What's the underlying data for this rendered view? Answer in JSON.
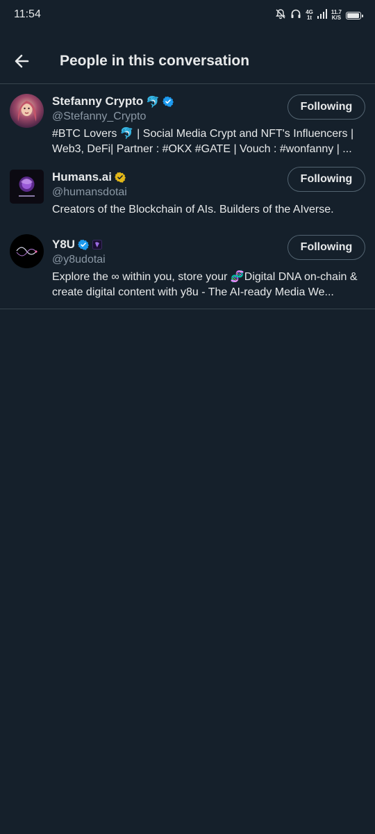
{
  "status_bar": {
    "time": "11:54",
    "network": "4G",
    "network_sub": "1t",
    "speed_value": "11.7",
    "speed_unit": "K/S",
    "battery_level": 0.95,
    "icons": [
      "mute-icon",
      "headset-icon",
      "signal-icon",
      "battery-icon"
    ]
  },
  "header": {
    "title": "People in this conversation",
    "back_icon": "arrow-left-icon"
  },
  "users": [
    {
      "name": "Stefanny Crypto",
      "name_suffix": "🐬",
      "verified": "blue",
      "handle": "@Stefanny_Crypto",
      "bio": "#BTC Lovers 🐬 | Social Media Crypt and NFT's Influencers | Web3, DeFi| Partner : #OKX #GATE | Vouch : #wonfanny | ...",
      "button": "Following",
      "avatar_shape": "round"
    },
    {
      "name": "Humans.ai",
      "name_suffix": "",
      "verified": "gold",
      "handle": "@humansdotai",
      "bio": "Creators of the Blockchain of AIs. Builders of the AIverse.",
      "button": "Following",
      "avatar_shape": "square"
    },
    {
      "name": "Y8U",
      "name_suffix": "",
      "verified": "blue",
      "handle": "@y8udotai",
      "bio": "Explore the ∞ within you, store your 🧬Digital DNA on-chain & create digital content with y8u - The AI-ready Media We...",
      "button": "Following",
      "avatar_shape": "round"
    }
  ],
  "colors": {
    "background": "#15202b",
    "divider": "#38444d",
    "text_primary": "#e7e9ea",
    "text_secondary": "#8b98a5",
    "verified_blue": "#1d9bf0",
    "verified_gold": "#e2b719"
  }
}
